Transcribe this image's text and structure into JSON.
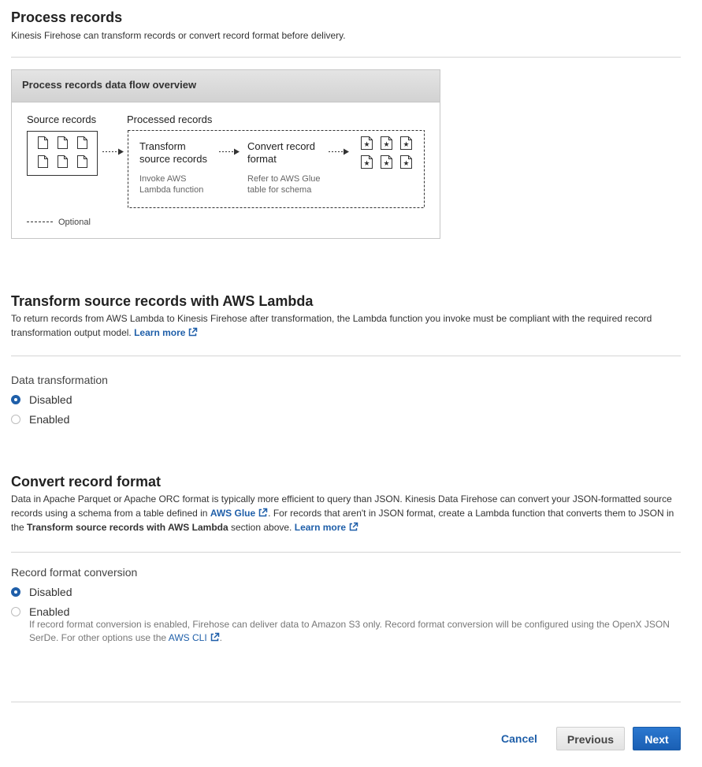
{
  "process": {
    "title": "Process records",
    "description": "Kinesis Firehose can transform records or convert record format before delivery."
  },
  "diagram": {
    "header": "Process records data flow overview",
    "source_label": "Source records",
    "processed_label": "Processed records",
    "transform_line1": "Transform",
    "transform_line2": "source records",
    "transform_sub1": "Invoke AWS",
    "transform_sub2": "Lambda function",
    "convert_line1": "Convert record",
    "convert_line2": "format",
    "convert_sub1": "Refer to AWS Glue",
    "convert_sub2": "table for schema",
    "legend": "Optional"
  },
  "transform": {
    "title": "Transform source records with AWS Lambda",
    "desc": "To return records from AWS Lambda to Kinesis Firehose after transformation, the Lambda function you invoke must be compliant with the required record transformation output model.",
    "learn_more": "Learn more",
    "group_label": "Data transformation",
    "options": [
      "Disabled",
      "Enabled"
    ],
    "selected": "Disabled"
  },
  "convert": {
    "title": "Convert record format",
    "desc_part1": "Data in Apache Parquet or Apache ORC format is typically more efficient to query than JSON. Kinesis Data Firehose can convert your JSON-formatted source records using a schema from a table defined in",
    "glue_link": "AWS Glue",
    "desc_part2": ". For records that aren't in JSON format, create a Lambda function that converts them to JSON in the",
    "desc_bold": "Transform source records with AWS Lambda",
    "desc_part3": "section above.",
    "learn_more": "Learn more",
    "group_label": "Record format conversion",
    "options": [
      "Disabled",
      "Enabled"
    ],
    "selected": "Disabled",
    "note_part1": "If record format conversion is enabled, Firehose can deliver data to Amazon S3 only. Record format conversion will be configured using the OpenX JSON SerDe. For other options use the",
    "cli_link": "AWS CLI",
    "note_part2": "."
  },
  "footer": {
    "cancel": "Cancel",
    "previous": "Previous",
    "next": "Next"
  },
  "colors": {
    "link": "#1f5fa9",
    "primary": "#1f5fa9"
  }
}
